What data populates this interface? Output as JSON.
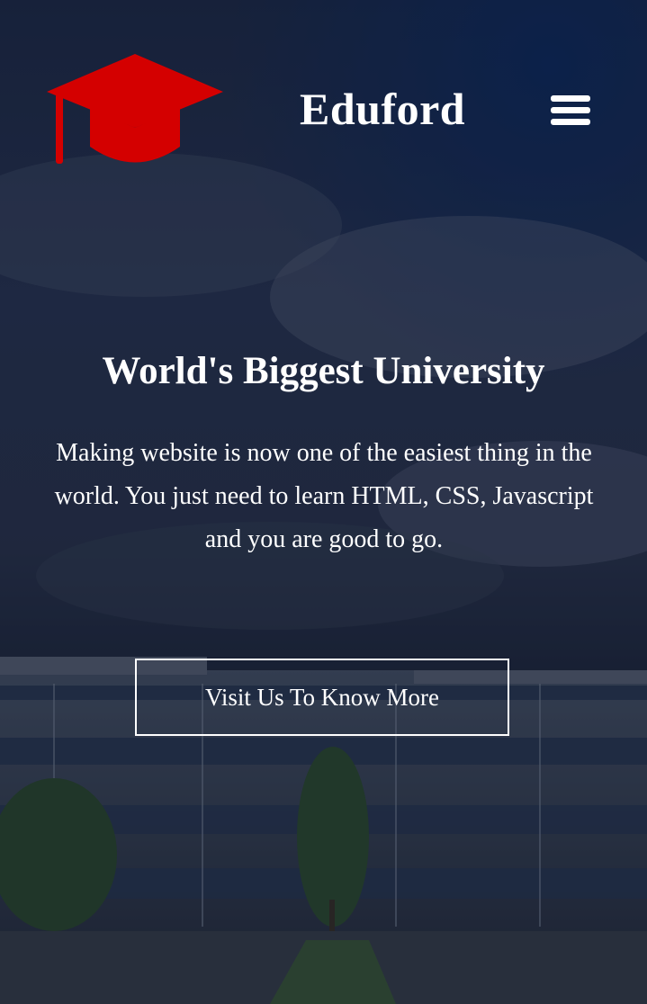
{
  "header": {
    "brand": "Eduford",
    "logo_icon": "graduation-cap-icon",
    "menu_icon": "hamburger-menu-icon",
    "logo_color": "#d40000"
  },
  "hero": {
    "title": "World's Biggest University",
    "description": "Making website is now one of the easiest thing in the world. You just need to learn HTML, CSS, Javascript and you are good to go.",
    "cta_label": "Visit Us To Know More"
  }
}
